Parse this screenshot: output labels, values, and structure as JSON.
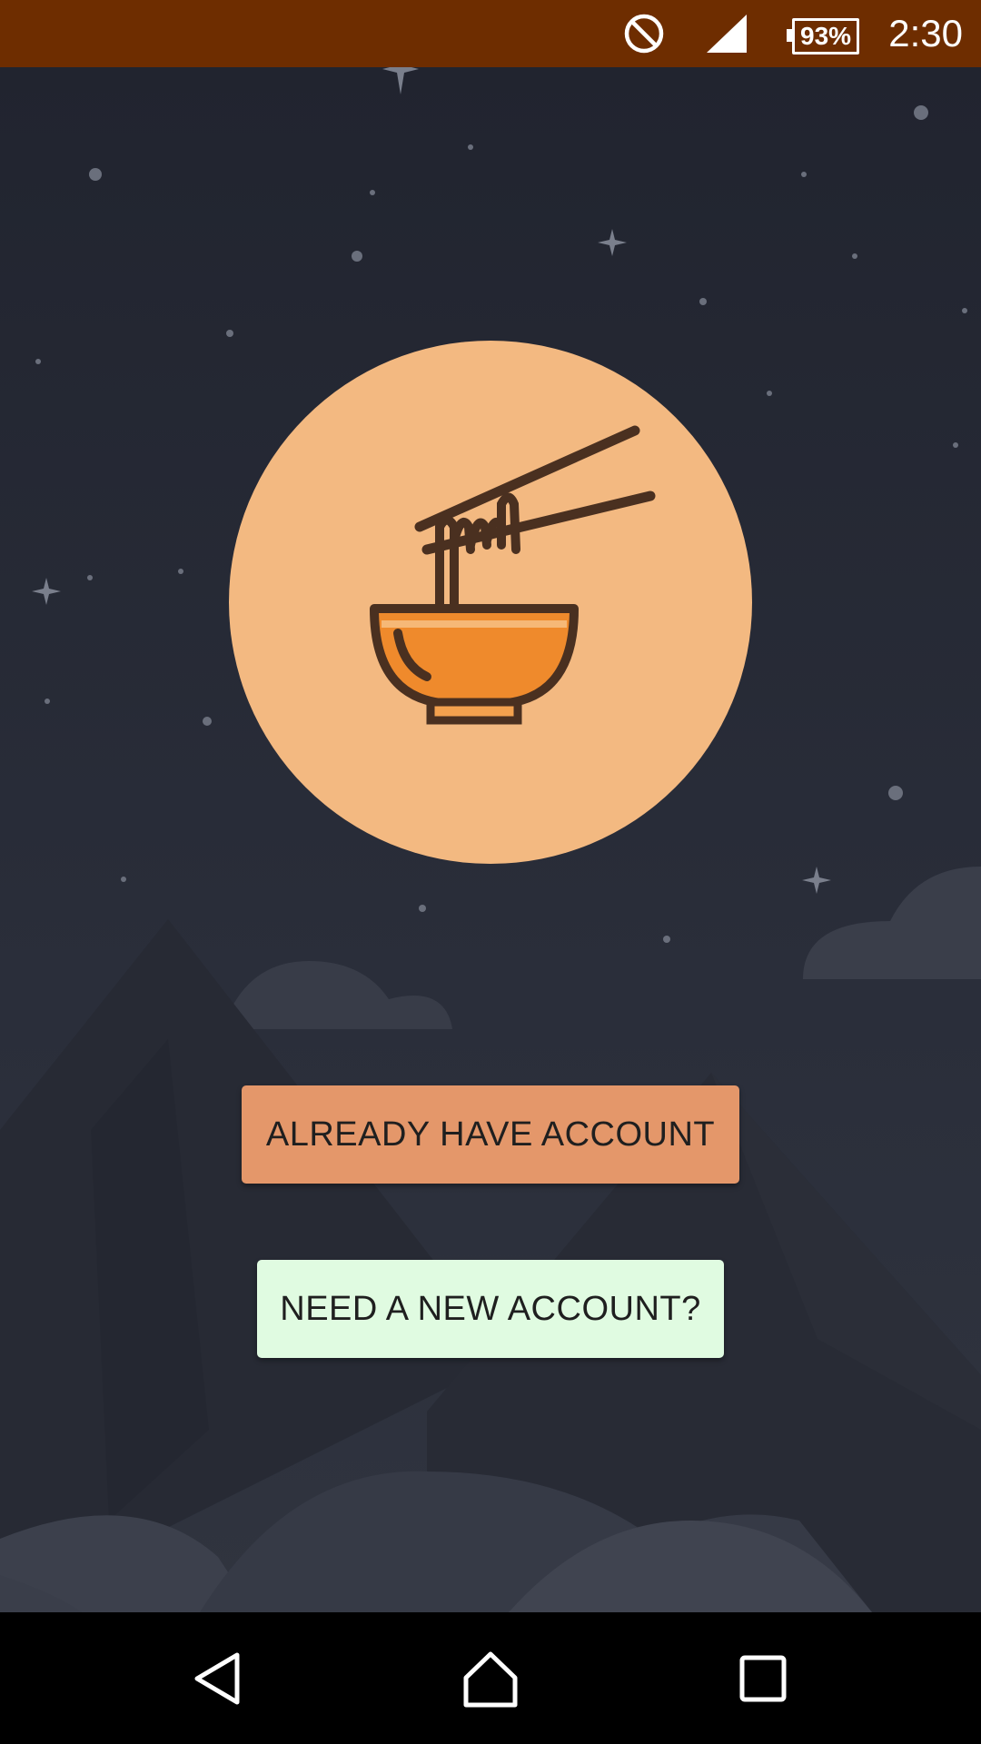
{
  "status_bar": {
    "battery_percent": "93%",
    "clock": "2:30",
    "icons": [
      "do-not-disturb-icon",
      "signal-icon",
      "battery-icon"
    ]
  },
  "logo": {
    "icon": "noodle-bowl-icon",
    "circle_color": "#f3b981",
    "bowl_color": "#ef8a2c",
    "stroke_color": "#4a3020"
  },
  "actions": {
    "login_label": "ALREADY HAVE ACCOUNT",
    "signup_label": "NEED A NEW ACCOUNT?",
    "login_color": "#e4976a",
    "signup_color": "#e0fbe1"
  },
  "nav_bar": {
    "icons": [
      "back-icon",
      "home-icon",
      "recents-icon"
    ]
  },
  "colors": {
    "status_bar": "#6e2d00",
    "background": "#21242f"
  }
}
